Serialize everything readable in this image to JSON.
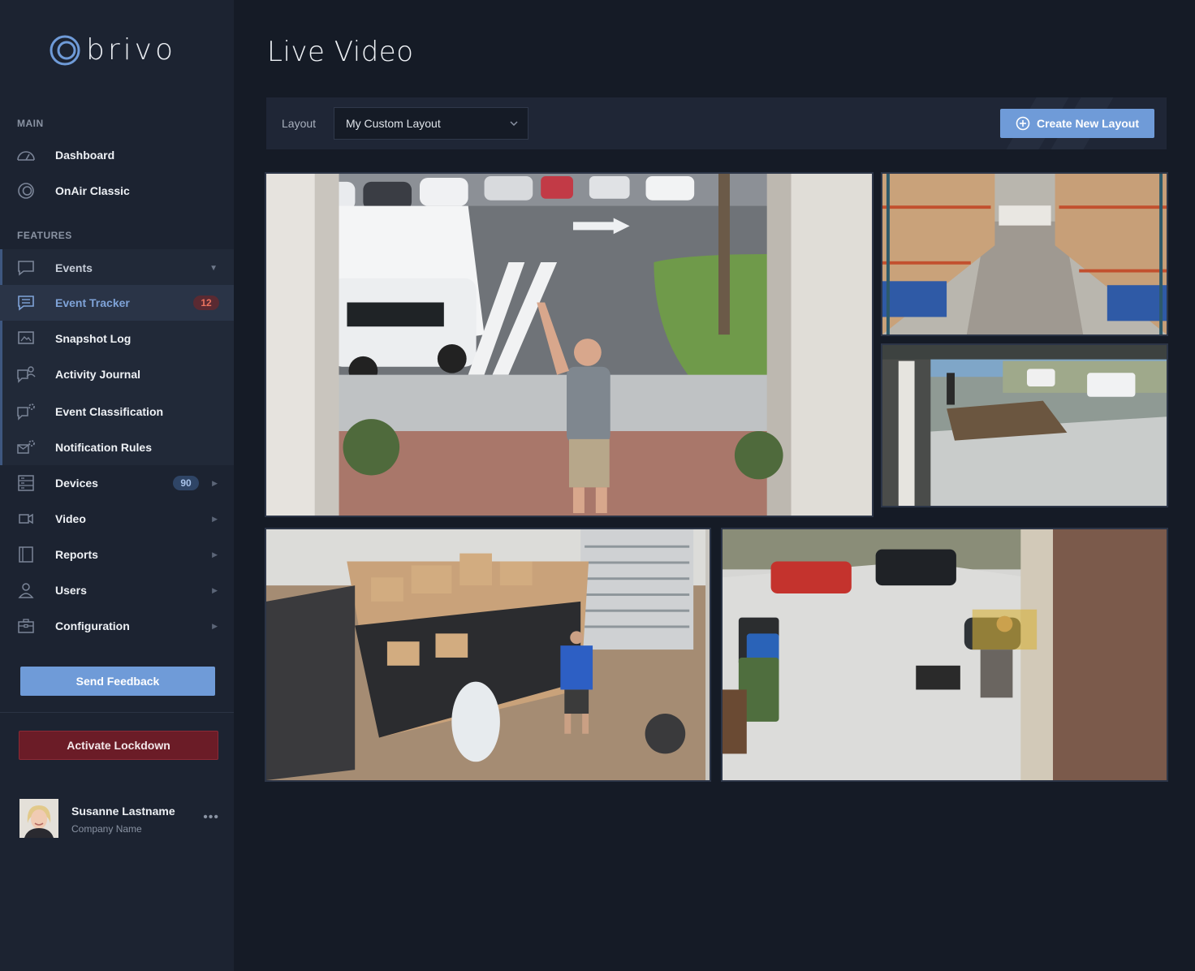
{
  "brand": {
    "name": "brivo"
  },
  "sidebar": {
    "main_label": "MAIN",
    "features_label": "FEATURES",
    "main_items": [
      {
        "label": "Dashboard",
        "icon": "gauge-icon"
      },
      {
        "label": "OnAir Classic",
        "icon": "onair-icon"
      }
    ],
    "events": {
      "label": "Events",
      "icon": "chat-icon"
    },
    "event_items": [
      {
        "label": "Event Tracker",
        "icon": "tracker-icon",
        "badge": "12"
      },
      {
        "label": "Snapshot Log",
        "icon": "snapshot-icon"
      },
      {
        "label": "Activity Journal",
        "icon": "journal-icon"
      },
      {
        "label": "Event Classification",
        "icon": "classification-icon"
      },
      {
        "label": "Notification Rules",
        "icon": "notification-icon"
      }
    ],
    "feature_items": [
      {
        "label": "Devices",
        "icon": "devices-icon",
        "badge": "90"
      },
      {
        "label": "Video",
        "icon": "video-icon"
      },
      {
        "label": "Reports",
        "icon": "reports-icon"
      },
      {
        "label": "Users",
        "icon": "user-icon"
      },
      {
        "label": "Configuration",
        "icon": "toolbox-icon"
      }
    ],
    "send_feedback": "Send Feedback",
    "activate_lockdown": "Activate Lockdown",
    "user": {
      "name": "Susanne Lastname",
      "company": "Company Name",
      "more": "•••"
    }
  },
  "page": {
    "title": "Live Video"
  },
  "toolbar": {
    "layout_label": "Layout",
    "layout_value": "My Custom Layout",
    "create_button": "Create New Layout"
  },
  "feeds": [
    {
      "name": "parking-lot-camera"
    },
    {
      "name": "warehouse-aisle-camera"
    },
    {
      "name": "front-porch-camera"
    },
    {
      "name": "stockroom-camera"
    },
    {
      "name": "driveway-camera"
    }
  ],
  "colors": {
    "accent": "#6f9bd8",
    "lockdown": "#6b1c27",
    "badge_red_bg": "#5a2a32",
    "badge_red_text": "#e9725f",
    "badge_blue_bg": "#2f4566",
    "badge_blue_text": "#a8c3ea"
  }
}
